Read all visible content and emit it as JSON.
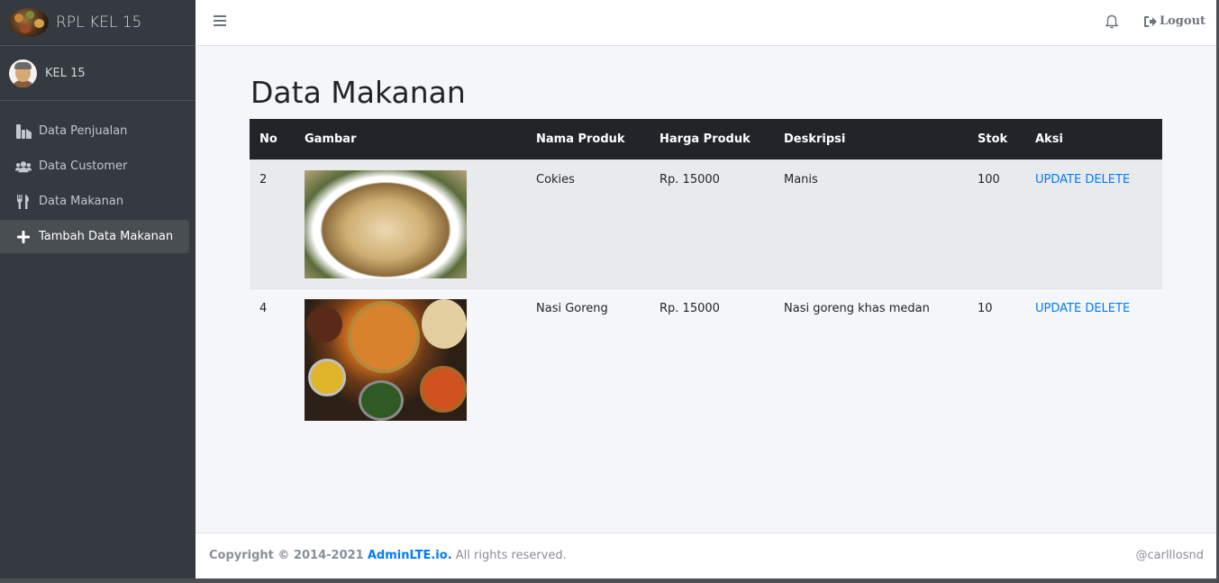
{
  "brand": {
    "name": "RPL KEL 15",
    "logo_icon": "food-platter-logo"
  },
  "user": {
    "name": "KEL 15",
    "avatar_icon": "user-avatar"
  },
  "sidebar": {
    "items": [
      {
        "label": "Data Penjualan",
        "icon": "sales-icon",
        "active": false
      },
      {
        "label": "Data Customer",
        "icon": "users-icon",
        "active": false
      },
      {
        "label": "Data Makanan",
        "icon": "utensils-icon",
        "active": false
      },
      {
        "label": "Tambah Data Makanan",
        "icon": "plus-icon",
        "active": true
      }
    ]
  },
  "topbar": {
    "menu_icon": "hamburger-icon",
    "bell_icon": "bell-icon",
    "logout_label": "Logout"
  },
  "page": {
    "title": "Data Makanan"
  },
  "table": {
    "headers": [
      "No",
      "Gambar",
      "Nama Produk",
      "Harga Produk",
      "Deskripsi",
      "Stok",
      "Aksi"
    ],
    "rows": [
      {
        "no": "2",
        "image": "soup-bowl-image",
        "nama": "Cokies",
        "harga": "Rp. 15000",
        "deskripsi": "Manis",
        "stok": "100",
        "update": "UPDATE",
        "delete": "DELETE"
      },
      {
        "no": "4",
        "image": "indian-dishes-image",
        "nama": "Nasi Goreng",
        "harga": "Rp. 15000",
        "deskripsi": "Nasi goreng khas medan",
        "stok": "10",
        "update": "UPDATE",
        "delete": "DELETE"
      }
    ]
  },
  "footer": {
    "copyright": "Copyright © 2014-2021",
    "link": "AdminLTE.io.",
    "rights": "All rights reserved.",
    "credit": "@carlllosnd"
  },
  "colors": {
    "sidebar_bg": "#343a40",
    "table_header": "#212529",
    "link": "#007bff",
    "content_bg": "#f4f6f9"
  }
}
